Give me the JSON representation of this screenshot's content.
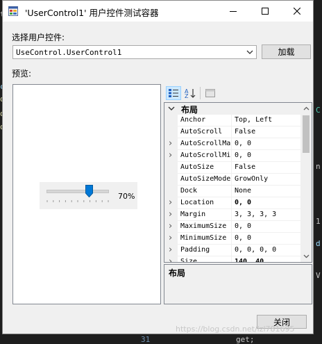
{
  "background": {
    "left_fragments": [
      "tr",
      "c",
      "ol",
      "ol",
      "ol"
    ],
    "right_fragments": [
      "C",
      "n",
      "1",
      "d",
      "V"
    ],
    "bottom_strip": [
      "31",
      "get;"
    ]
  },
  "window": {
    "title": "'UserControl1' 用户控件测试容器",
    "controls": {
      "minimize": "—",
      "maximize": "☐",
      "close": "✕"
    }
  },
  "select_label": "选择用户控件:",
  "combo": {
    "value": "UseControl.UserControl1"
  },
  "load_button": "加载",
  "preview_label": "预览:",
  "preview": {
    "slider": {
      "value": "70%",
      "level": 0.7
    }
  },
  "property_grid": {
    "category": "布局",
    "rows": [
      {
        "name": "Anchor",
        "value": "Top, Left",
        "expandable": false,
        "bold": false
      },
      {
        "name": "AutoScroll",
        "value": "False",
        "expandable": false,
        "bold": false
      },
      {
        "name": "AutoScrollMa",
        "value": "0, 0",
        "expandable": true,
        "bold": false
      },
      {
        "name": "AutoScrollMi",
        "value": "0, 0",
        "expandable": true,
        "bold": false
      },
      {
        "name": "AutoSize",
        "value": "False",
        "expandable": false,
        "bold": false
      },
      {
        "name": "AutoSizeMode",
        "value": "GrowOnly",
        "expandable": false,
        "bold": false
      },
      {
        "name": "Dock",
        "value": "None",
        "expandable": false,
        "bold": false
      },
      {
        "name": "Location",
        "value": "0, 0",
        "expandable": true,
        "bold": true
      },
      {
        "name": "Margin",
        "value": "3, 3, 3, 3",
        "expandable": true,
        "bold": false
      },
      {
        "name": "MaximumSize",
        "value": "0, 0",
        "expandable": true,
        "bold": false
      },
      {
        "name": "MinimumSize",
        "value": "0, 0",
        "expandable": true,
        "bold": false
      },
      {
        "name": "Padding",
        "value": "0, 0, 0, 0",
        "expandable": true,
        "bold": false
      },
      {
        "name": "Size",
        "value": "140, 40",
        "expandable": true,
        "bold": true
      }
    ],
    "description_title": "布局"
  },
  "close_button": "关闭",
  "watermark": "https://blog.csdn.net/lzl781695"
}
